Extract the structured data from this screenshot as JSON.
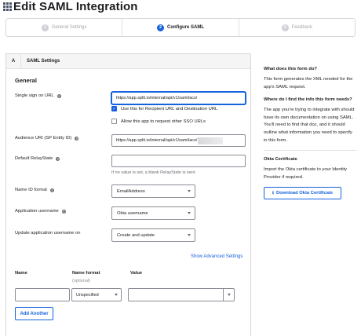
{
  "page": {
    "title": "Edit SAML Integration"
  },
  "wizard": {
    "steps": [
      {
        "num": "1",
        "label": "General Settings"
      },
      {
        "num": "2",
        "label": "Configure SAML"
      },
      {
        "num": "3",
        "label": "Feedback"
      }
    ],
    "active_step": 2
  },
  "panel": {
    "letter": "A",
    "title": "SAML Settings",
    "section": "General"
  },
  "form": {
    "sso_url": {
      "label": "Single sign on URL",
      "value": "https://app.split.io/internal/api/v1/saml/acs/"
    },
    "recipient_checkbox": {
      "label": "Use this for Recipient URL and Destination URL",
      "checked": true
    },
    "other_sso_checkbox": {
      "label": "Allow this app to request other SSO URLs",
      "checked": false
    },
    "audience_uri": {
      "label": "Audience URI (SP Entity ID)",
      "value": "https://app.split.io/internal/api/v1/saml/acs/"
    },
    "relay_state": {
      "label": "Default RelayState",
      "value": "",
      "hint": "If no value is set, a blank RelayState is sent"
    },
    "name_id_format": {
      "label": "Name ID format",
      "value": "EmailAddress"
    },
    "app_username": {
      "label": "Application username",
      "value": "Okta username"
    },
    "update_username": {
      "label": "Update application username on",
      "value": "Create and update"
    },
    "advanced_link": "Show Advanced Settings"
  },
  "attributes": {
    "col_name": "Name",
    "col_format": "Name format",
    "col_format_sub": "(optional)",
    "col_value": "Value",
    "format_value": "Unspecified",
    "add_button": "Add Another"
  },
  "sidebar": {
    "q1": "What does this form do?",
    "a1": "This form generates the XML needed for the app's SAML request.",
    "q2": "Where do I find the info this form needs?",
    "a2": "The app you're trying to integrate with should have its own documentation on using SAML. You'll need to find that doc, and it should outline what information you need to specify in this form.",
    "cert_title": "Okta Certificate",
    "cert_text": "Import the Okta certificate to your Identity Provider if required.",
    "download_button": "Download Okta Certificate"
  },
  "colors": {
    "accent": "#1662dd",
    "border": "#8c8c96"
  }
}
